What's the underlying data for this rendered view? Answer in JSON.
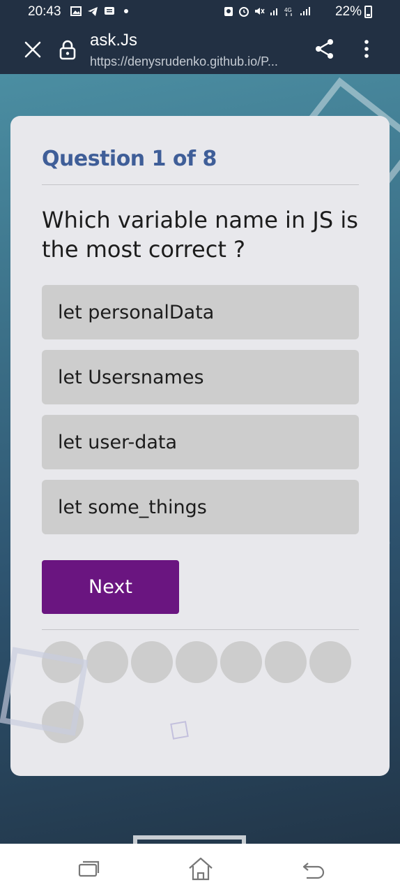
{
  "status_bar": {
    "time": "20:43",
    "battery": "22%"
  },
  "browser": {
    "title": "ask.Js",
    "url": "https://denysrudenko.github.io/P..."
  },
  "quiz": {
    "counter": "Question 1 of 8",
    "question": "Which variable name in JS is the most correct ?",
    "answers": [
      "let personalData",
      "let Usersnames",
      "let user-data",
      "let some_things"
    ],
    "next_label": "Next",
    "total_questions": 8,
    "answered": 0
  },
  "colors": {
    "accent": "#6a1580",
    "heading": "#3f5e98",
    "answer_bg": "#cdcdcd",
    "card_bg": "#e8e8ec"
  }
}
